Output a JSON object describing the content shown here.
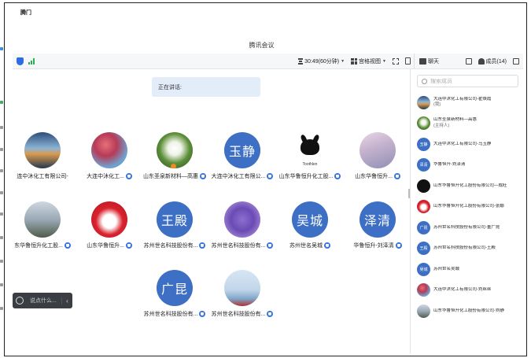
{
  "outer": {
    "label": "腾门"
  },
  "window": {
    "title": "腾讯会议"
  },
  "toolbar": {
    "timer": "30:49(60分钟)",
    "view_label": "宫格视图",
    "chat_label": "聊天",
    "members_label": "成员(14)"
  },
  "speaking": {
    "label": "正在讲话:"
  },
  "tiles": [
    {
      "name": "连中沐化工有限公司-",
      "avatar": "av-sunset",
      "text": "",
      "shield": false
    },
    {
      "name": "大连中沐化工...",
      "avatar": "av-mermaid",
      "text": "",
      "shield": true
    },
    {
      "name": "山东圣泉新材料—高惠",
      "avatar": "av-flower",
      "text": "",
      "shield": true,
      "host": true
    },
    {
      "name": "大连中沐化工有限公...",
      "avatar": "text-av",
      "text": "玉静",
      "shield": true
    },
    {
      "name": "山东华鲁恒升化工股...",
      "avatar": "av-toothless",
      "text": "Toothlen",
      "shield": true
    },
    {
      "name": "山东华鲁恒升...",
      "avatar": "av-girl",
      "text": "",
      "shield": true
    },
    {
      "name": "东华鲁恒升化工股...",
      "avatar": "av-kid",
      "text": "",
      "shield": true
    },
    {
      "name": "山东华鲁恒升...",
      "avatar": "av-rabbit",
      "text": "",
      "shield": true
    },
    {
      "name": "苏州世名科技股份有...",
      "avatar": "text-av",
      "text": "王殿",
      "shield": true
    },
    {
      "name": "苏州世名科技股份有...",
      "avatar": "av-monster",
      "text": "",
      "shield": true
    },
    {
      "name": "苏州世名吴城",
      "avatar": "text-av",
      "text": "吴城",
      "shield": true
    },
    {
      "name": "华鲁恒升-刘泽清",
      "avatar": "text-av",
      "text": "泽清",
      "shield": true
    },
    {
      "name": "苏州世名科技股份有...",
      "avatar": "text-av",
      "text": "广昆",
      "shield": true
    },
    {
      "name": "苏州世名科技股份有...",
      "avatar": "av-sea",
      "text": "",
      "shield": true
    }
  ],
  "bubble": {
    "placeholder": "说点什么..."
  },
  "members": {
    "search_placeholder": "搜索成员",
    "list": [
      {
        "name": "大连中沐化工有限公司-翟焕霞",
        "sub": "(我)",
        "avatar": "av-sunset",
        "text": ""
      },
      {
        "name": "山东圣泉新材料—高惠",
        "sub": "(主持人)",
        "avatar": "av-flower",
        "text": ""
      },
      {
        "name": "大连中沐化工有限公司-马玉静",
        "sub": "",
        "avatar": "text-av",
        "text": "玉静"
      },
      {
        "name": "华鲁恒升-刘泽清",
        "sub": "",
        "avatar": "text-av",
        "text": "泽清"
      },
      {
        "name": "山东华鲁恒升化工股份有限公司—成旺",
        "sub": "",
        "avatar": "av-toothless",
        "text": ""
      },
      {
        "name": "山东华鲁恒升化工股份有限公司-张娜",
        "sub": "",
        "avatar": "av-rabbit",
        "text": ""
      },
      {
        "name": "苏州世名科技股份有限公司-董广昆",
        "sub": "",
        "avatar": "text-av",
        "text": "广昆"
      },
      {
        "name": "苏州世名科技股份有限公司-王殿",
        "sub": "",
        "avatar": "text-av",
        "text": "王殿"
      },
      {
        "name": "苏州世名吴城",
        "sub": "",
        "avatar": "text-av",
        "text": "吴城"
      },
      {
        "name": "大连中沐化工有限公司-刘丝丝",
        "sub": "",
        "avatar": "av-mermaid",
        "text": ""
      },
      {
        "name": "山东华鲁恒升化工股份有限公司-刘静",
        "sub": "",
        "avatar": "av-kid",
        "text": ""
      }
    ]
  },
  "colors": {
    "accent": "#3d6fc4",
    "signal": "#2bb24c",
    "host_badge": "#f08a24",
    "speaking_bg": "#e3edf9"
  }
}
